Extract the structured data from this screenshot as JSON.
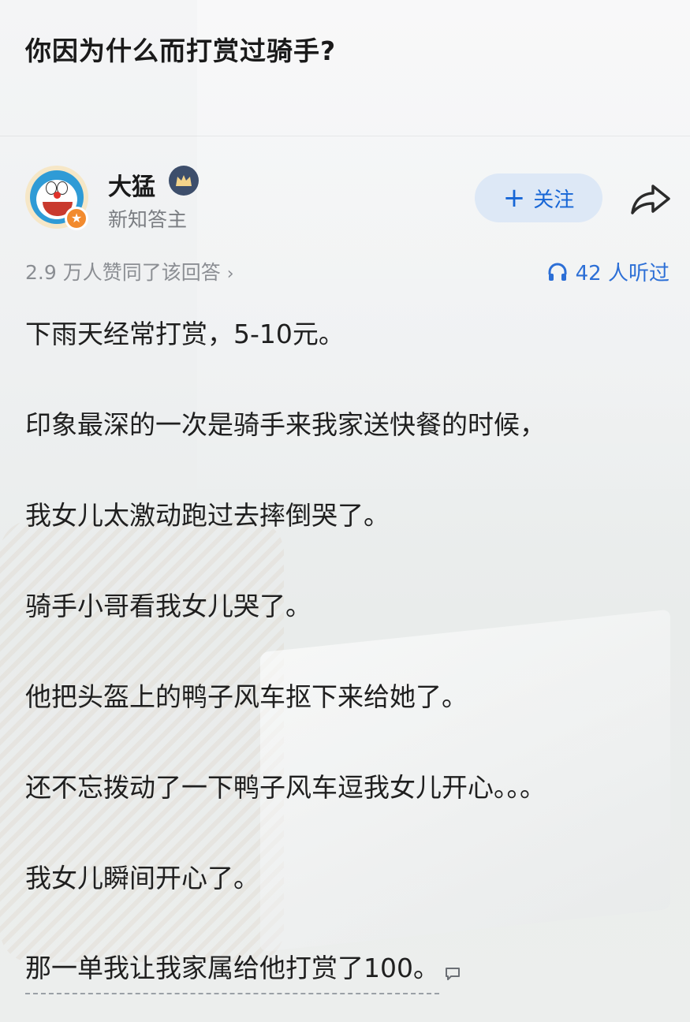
{
  "question": {
    "title": "你因为什么而打赏过骑手?"
  },
  "author": {
    "name": "大猛",
    "title": "新知答主",
    "avatar_icon": "doraemon-avatar",
    "badge_icon": "crown-icon",
    "level_icon": "star-badge-icon"
  },
  "actions": {
    "follow_label": "关注",
    "follow_icon": "plus-icon",
    "share_icon": "share-arrow-icon"
  },
  "stats": {
    "agree_text": "2.9 万人赞同了该回答",
    "listen_text": "42 人听过",
    "listen_icon": "headphone-icon"
  },
  "answer": {
    "paragraphs": [
      "下雨天经常打赏，5-10元。",
      "印象最深的一次是骑手来我家送快餐的时候，",
      "我女儿太激动跑过去摔倒哭了。",
      "骑手小哥看我女儿哭了。",
      "他把头盔上的鸭子风车抠下来给她了。",
      "还不忘拨动了一下鸭子风车逗我女儿开心。。。",
      "我女儿瞬间开心了。",
      "那一单我让我家属给他打赏了100。"
    ]
  },
  "colors": {
    "accent": "#1766d6",
    "follow_bg": "#dde8f6",
    "muted": "#8b8e93"
  }
}
